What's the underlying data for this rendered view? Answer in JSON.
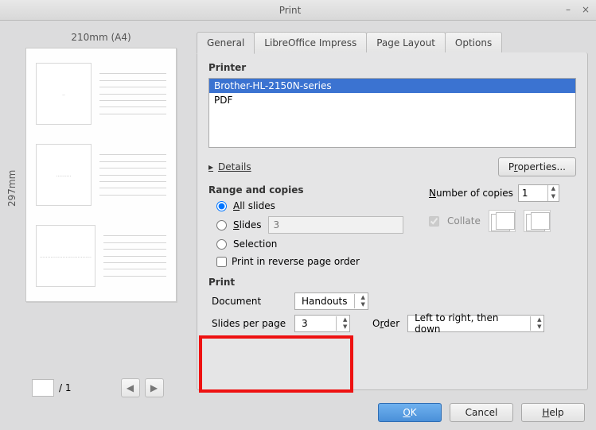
{
  "window": {
    "title": "Print"
  },
  "tabs": {
    "general": "General",
    "impress": "LibreOffice Impress",
    "page_layout": "Page Layout",
    "options": "Options"
  },
  "preview": {
    "width_label": "210mm (A4)",
    "height_label": "297mm",
    "page_current": "",
    "page_total": "/ 1"
  },
  "printer": {
    "header": "Printer",
    "items": [
      "Brother-HL-2150N-series",
      "PDF"
    ],
    "selected_index": 0,
    "details": "Details",
    "properties": "Properties..."
  },
  "range": {
    "header": "Range and copies",
    "all_slides": "All slides",
    "slides": "Slides",
    "slides_value": "3",
    "selection": "Selection",
    "reverse": "Print in reverse page order",
    "copies_label": "Number of copies",
    "copies_value": "1",
    "collate": "Collate"
  },
  "print": {
    "header": "Print",
    "document_label": "Document",
    "document_value": "Handouts",
    "spp_label": "Slides per page",
    "spp_value": "3",
    "order_label": "Order",
    "order_value": "Left to right, then down"
  },
  "footer": {
    "ok": "OK",
    "cancel": "Cancel",
    "help": "Help"
  }
}
